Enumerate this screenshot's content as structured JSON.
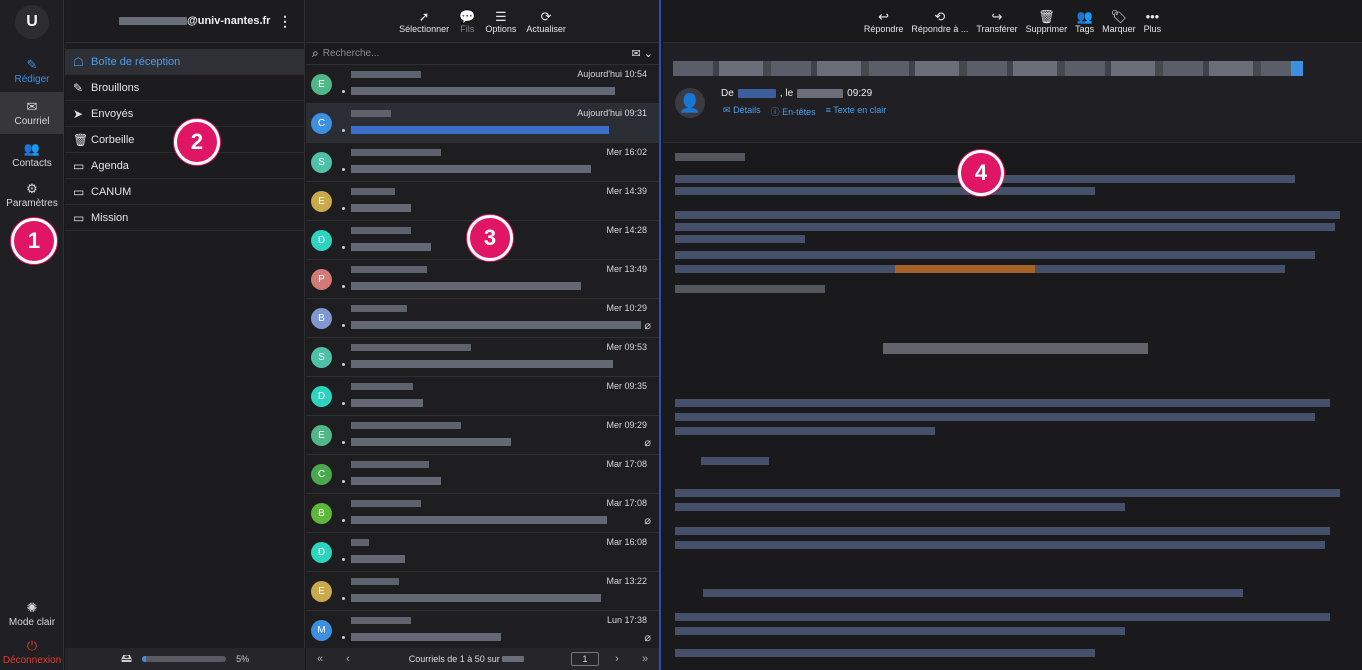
{
  "nav": {
    "logo": "U",
    "compose": "Rédiger",
    "mail": "Courriel",
    "contacts": "Contacts",
    "settings": "Paramètres",
    "light_mode": "Mode clair",
    "logout": "Déconnexion"
  },
  "account": {
    "email_suffix": "@univ-nantes.fr"
  },
  "folders": [
    {
      "label": "Boîte de réception",
      "icon": "inbox-icon",
      "selected": true
    },
    {
      "label": "Brouillons",
      "icon": "pencil-icon"
    },
    {
      "label": "Envoyés",
      "icon": "paper-plane-icon"
    },
    {
      "label": "Corbeille",
      "icon": "trash-icon"
    },
    {
      "label": "Agenda",
      "icon": "folder-icon"
    },
    {
      "label": "CANUM",
      "icon": "folder-icon"
    },
    {
      "label": "Mission",
      "icon": "folder-icon"
    }
  ],
  "quota": {
    "percent_label": "5%",
    "percent": 5
  },
  "list_toolbar": {
    "select": "Sélectionner",
    "threads": "Fils",
    "options": "Options",
    "refresh": "Actualiser"
  },
  "search": {
    "placeholder": "Recherche..."
  },
  "messages": [
    {
      "initial": "E",
      "color": "#52b788",
      "date": "Aujourd'hui 10:54",
      "attach": false,
      "selected": false
    },
    {
      "initial": "C",
      "color": "#3d8fe0",
      "date": "Aujourd'hui 09:31",
      "attach": false,
      "selected": true
    },
    {
      "initial": "S",
      "color": "#4fc1a8",
      "date": "Mer 16:02",
      "attach": false,
      "selected": false
    },
    {
      "initial": "E",
      "color": "#c9a94a",
      "date": "Mer 14:39",
      "attach": false,
      "selected": false
    },
    {
      "initial": "D",
      "color": "#2ed3c0",
      "date": "Mer 14:28",
      "attach": false,
      "selected": false
    },
    {
      "initial": "P",
      "color": "#d47a76",
      "date": "Mer 13:49",
      "attach": false,
      "selected": false
    },
    {
      "initial": "B",
      "color": "#7f98d2",
      "date": "Mer 10:29",
      "attach": true,
      "selected": false
    },
    {
      "initial": "S",
      "color": "#4fc1a8",
      "date": "Mer 09:53",
      "attach": false,
      "selected": false
    },
    {
      "initial": "D",
      "color": "#2ed3c0",
      "date": "Mer 09:35",
      "attach": false,
      "selected": false
    },
    {
      "initial": "E",
      "color": "#52b788",
      "date": "Mer 09:29",
      "attach": true,
      "selected": false
    },
    {
      "initial": "C",
      "color": "#4aa84f",
      "date": "Mar 17:08",
      "attach": false,
      "selected": false
    },
    {
      "initial": "B",
      "color": "#5cb83a",
      "date": "Mar 17:08",
      "attach": true,
      "selected": false
    },
    {
      "initial": "D",
      "color": "#2ed3c0",
      "date": "Mar 16:08",
      "attach": false,
      "selected": false
    },
    {
      "initial": "E",
      "color": "#c9a94a",
      "date": "Mar 13:22",
      "attach": false,
      "selected": false
    },
    {
      "initial": "M",
      "color": "#3d8fe0",
      "date": "Lun 17:38",
      "attach": true,
      "selected": false
    }
  ],
  "pager": {
    "first": "«",
    "prev": "‹",
    "label": "Courriels de 1 à 50 sur",
    "page": "1",
    "next": "›",
    "last": "»"
  },
  "read_toolbar": {
    "reply": "Répondre",
    "reply_all": "Répondre à ...",
    "forward": "Transférer",
    "delete": "Supprimer",
    "tags": "Tags",
    "mark": "Marquer",
    "more": "Plus"
  },
  "read_header": {
    "from_prefix": "De",
    "date_prefix": ", le",
    "time": "09:29",
    "details": "Détails",
    "headers": "En-têtes",
    "plaintext": "Texte en clair"
  },
  "annotations": [
    "1",
    "2",
    "3",
    "4"
  ],
  "colors": {
    "accent": "#3d8fe0",
    "badge": "#e01566",
    "logout": "#e03a2f"
  }
}
